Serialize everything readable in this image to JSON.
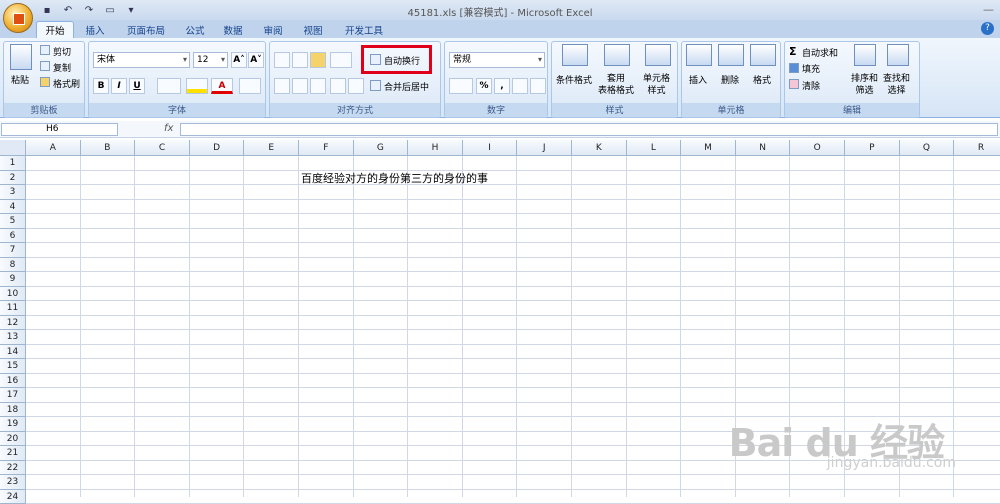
{
  "window": {
    "title": "45181.xls  [兼容模式] - Microsoft Excel",
    "help_label": "?"
  },
  "tabs": [
    "开始",
    "插入",
    "页面布局",
    "公式",
    "数据",
    "审阅",
    "视图",
    "开发工具"
  ],
  "clipboard": {
    "paste": "粘贴",
    "cut": "剪切",
    "copy": "复制",
    "format_painter": "格式刷",
    "group": "剪贴板"
  },
  "font": {
    "name": "宋体",
    "size": "12",
    "bold": "B",
    "italic": "I",
    "underline": "U",
    "font_color_glyph": "A",
    "grow": "A˄",
    "shrink": "A˅",
    "group": "字体"
  },
  "alignment": {
    "wrap_text": "自动换行",
    "merge_center": "合并后居中",
    "group": "对齐方式"
  },
  "number": {
    "format": "常规",
    "percent": "%",
    "comma": ",",
    "group": "数字"
  },
  "styles": {
    "conditional": "条件格式",
    "table": "套用\n表格格式",
    "cell": "单元格\n样式",
    "group": "样式"
  },
  "cells": {
    "insert": "插入",
    "delete": "删除",
    "format": "格式",
    "group": "单元格"
  },
  "editing": {
    "autosum": "自动求和",
    "fill": "填充",
    "clear": "清除",
    "sort": "排序和\n筛选",
    "find": "查找和\n选择",
    "sigma": "Σ",
    "group": "编辑"
  },
  "formula_bar": {
    "name_box": "H6",
    "fx": "fx",
    "value": ""
  },
  "columns": [
    "A",
    "B",
    "C",
    "D",
    "E",
    "F",
    "G",
    "H",
    "I",
    "J",
    "K",
    "L",
    "M",
    "N",
    "O",
    "P",
    "Q",
    "R"
  ],
  "rows": [
    "1",
    "2",
    "3",
    "4",
    "5",
    "6",
    "7",
    "8",
    "9",
    "10",
    "11",
    "12",
    "13",
    "14",
    "15",
    "16",
    "17",
    "18",
    "19",
    "20",
    "21",
    "22",
    "23",
    "24"
  ],
  "cell_F2": "百度经验对方的身份第三方的身份的事",
  "watermark": {
    "logo": "Bai du 经验",
    "url": "jingyan.baidu.com"
  }
}
